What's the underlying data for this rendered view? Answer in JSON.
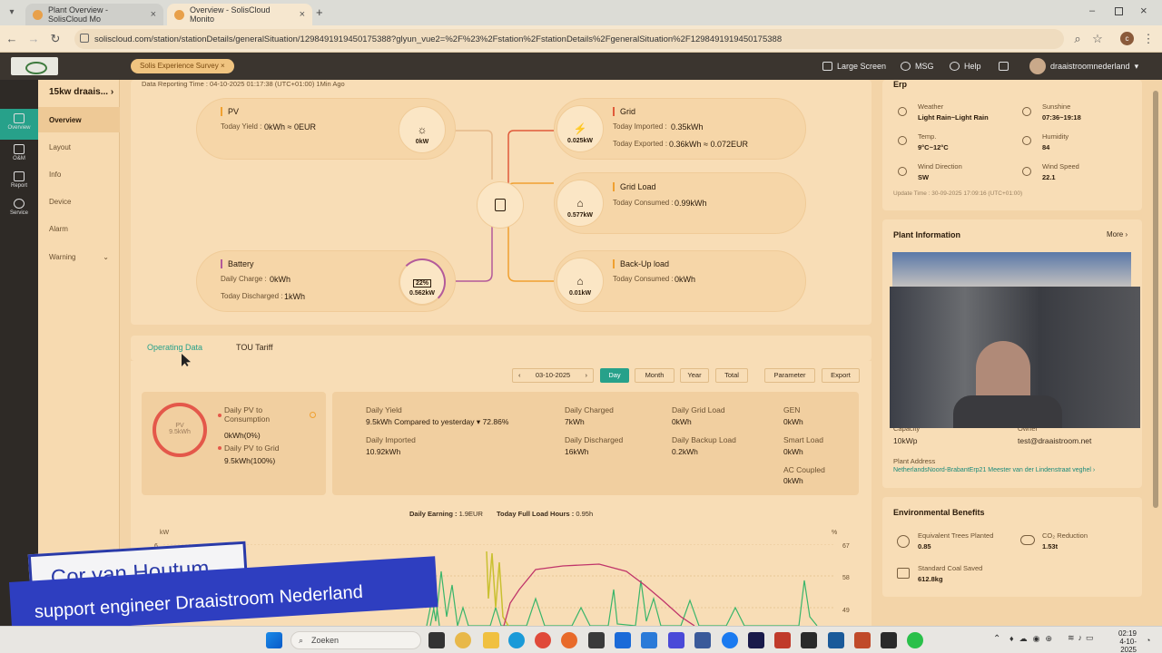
{
  "browser": {
    "tabs": [
      {
        "label": "Plant Overview - SolisCloud Mo"
      },
      {
        "label": "Overview - SolisCloud Monito"
      }
    ],
    "new_tab": "+",
    "url": "soliscloud.com/station/stationDetails/generalSituation/1298491919450175388?glyun_vue2=%2F%23%2Fstation%2FstationDetails%2FgeneralSituation%2F1298491919450175388",
    "profile_initial": "c"
  },
  "header": {
    "survey": "Solis Experience Survey",
    "large_screen": "Large Screen",
    "msg": "MSG",
    "help": "Help",
    "user": "draaistroomnederland"
  },
  "leftnav": [
    {
      "label": "Overview"
    },
    {
      "label": "O&M"
    },
    {
      "label": "Report"
    },
    {
      "label": "Service"
    }
  ],
  "subnav": {
    "station": "15kw draais...",
    "items": [
      "Overview",
      "Layout",
      "Info",
      "Device",
      "Alarm",
      "Warning"
    ]
  },
  "flow": {
    "reporting": "Data Reporting Time :  04-10-2025 01:17:38 (UTC+01:00) 1Min Ago",
    "pv": {
      "title": "PV",
      "k": "Today Yield :",
      "v": "0kWh ≈ 0EUR",
      "power": "0kW"
    },
    "battery": {
      "title": "Battery",
      "k1": "Daily Charge :",
      "v1": "0kWh",
      "k2": "Today Discharged :",
      "v2": "1kWh",
      "power": "0.562kW",
      "soc": "22%"
    },
    "grid": {
      "title": "Grid",
      "k1": "Today Imported :",
      "v1": "0.35kWh",
      "k2": "Today Exported :",
      "v2": "0.36kWh ≈ 0.072EUR",
      "power": "0.025kW"
    },
    "gridload": {
      "title": "Grid Load",
      "k": "Today Consumed :",
      "v": "0.99kWh",
      "power": "0.577kW"
    },
    "backup": {
      "title": "Back-Up load",
      "k": "Today Consumed :",
      "v": "0kWh",
      "power": "0.01kW"
    }
  },
  "tabs": {
    "operating": "Operating Data",
    "tou": "TOU Tariff"
  },
  "toolbar": {
    "date": "03-10-2025",
    "prev": "‹",
    "next": "›",
    "day": "Day",
    "month": "Month",
    "year": "Year",
    "total": "Total",
    "parameter": "Parameter",
    "export": "Export"
  },
  "stats": {
    "ring_label": "PV",
    "ring_value": "9.5kWh",
    "pv_cons_k": "Daily PV to Consumption",
    "pv_cons_v": "0kWh(0%)",
    "pv_grid_k": "Daily PV to Grid",
    "pv_grid_v": "9.5kWh(100%)",
    "yield_k": "Daily Yield",
    "yield_v": "9.5kWh Compared to yesterday",
    "yield_pct": "72.86%",
    "imported_k": "Daily Imported",
    "imported_v": "10.92kWh",
    "charged_k": "Daily Charged",
    "charged_v": "7kWh",
    "discharged_k": "Daily Discharged",
    "discharged_v": "16kWh",
    "gridload_k": "Daily Grid Load",
    "gridload_v": "0kWh",
    "backup_k": "Daily Backup Load",
    "backup_v": "0.2kWh",
    "gen_k": "GEN",
    "gen_v": "0kWh",
    "smart_k": "Smart Load",
    "smart_v": "0kWh",
    "ac_k": "AC Coupled",
    "ac_v": "0kWh"
  },
  "chart": {
    "earning_k": "Daily Earning",
    "earning_v": "1.9EUR",
    "hours_k": "Today Full Load Hours",
    "hours_v": "0.95h",
    "left_unit": "kW",
    "right_unit": "%",
    "left_tick": "6",
    "right_ticks": [
      "67",
      "58",
      "49"
    ]
  },
  "erp": {
    "title": "Erp",
    "weather_k": "Weather",
    "weather_v": "Light Rain~Light Rain",
    "sunshine_k": "Sunshine",
    "sunshine_v": "07:36~19:18",
    "temp_k": "Temp.",
    "temp_v": "9°C~12°C",
    "humidity_k": "Humidity",
    "humidity_v": "84",
    "wdir_k": "Wind Direction",
    "wdir_v": "SW",
    "wspeed_k": "Wind Speed",
    "wspeed_v": "22.1",
    "update": "Update Time :  30-09-2025 17:09:16 (UTC+01:00)"
  },
  "plant": {
    "title": "Plant Information",
    "more": "More",
    "capacity_k": "Capacity",
    "capacity_v": "10kWp",
    "owner_k": "Owner",
    "owner_v": "test@draaistroom.net",
    "address_k": "Plant Address",
    "address_v": "NetherlandsNoord-BrabantErp21 Meester van der Lindenstraat veghel"
  },
  "env": {
    "title": "Environmental Benefits",
    "trees_k": "Equivalent Trees Planted",
    "trees_v": "0.85",
    "co2_k": "CO₂ Reduction",
    "co2_v": "1.53t",
    "coal_k": "Standard Coal Saved",
    "coal_v": "612.8kg"
  },
  "overlay": {
    "name": "Cor van Houtum",
    "role": "support engineer Draaistroom   Nederland"
  },
  "taskbar": {
    "search": "Zoeken",
    "time": "02:19",
    "date": "4-10-2025"
  },
  "colors": {
    "accent": "#27a18a",
    "grid_line": "#e05a3a",
    "battery_line": "#b35a9a",
    "pv_line": "#f0a030"
  }
}
